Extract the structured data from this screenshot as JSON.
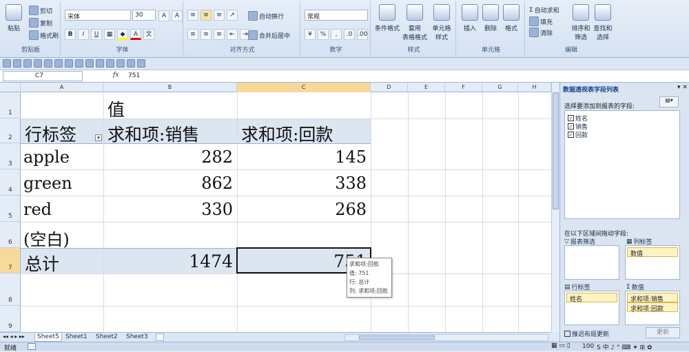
{
  "ribbon": {
    "clipboard": {
      "paste": "粘贴",
      "cut": "剪切",
      "copy": "复制",
      "format_painter": "格式刷",
      "label": "剪贴板"
    },
    "font": {
      "name": "宋体",
      "size": "30",
      "bold": "B",
      "italic": "I",
      "underline": "U",
      "label": "字体"
    },
    "alignment": {
      "wrap": "自动换行",
      "merge": "合并后居中",
      "label": "对齐方式"
    },
    "number": {
      "format": "常规",
      "percent": "%",
      "comma": ",",
      "label": "数字"
    },
    "styles": {
      "conditional": "条件格式",
      "table_format": "套用\n表格格式",
      "cell_style": "单元格\n样式",
      "label": "样式"
    },
    "cells": {
      "insert": "插入",
      "delete": "删除",
      "format": "格式",
      "label": "单元格"
    },
    "editing": {
      "autosum": "自动求和",
      "fill": "填充",
      "clear": "清除",
      "sort_filter": "排序和\n筛选",
      "find_select": "查找和\n选择",
      "label": "编辑"
    }
  },
  "formula": {
    "name_box": "C7",
    "fx": "fx",
    "value": "751"
  },
  "columns": [
    "A",
    "B",
    "C",
    "D",
    "E",
    "F",
    "G",
    "H"
  ],
  "rows": [
    "1",
    "2",
    "3",
    "4",
    "5",
    "6",
    "7",
    "8",
    "9"
  ],
  "pivot": {
    "values_header": "值",
    "row_label": "行标签",
    "col_b": "求和项:销售",
    "col_c": "求和项:回款",
    "data": [
      {
        "name": "apple",
        "sales": "282",
        "payment": "145"
      },
      {
        "name": "green",
        "sales": "862",
        "payment": "338"
      },
      {
        "name": "red",
        "sales": "330",
        "payment": "268"
      },
      {
        "name": "(空白)",
        "sales": "",
        "payment": ""
      }
    ],
    "total_label": "总计",
    "total_sales": "1474",
    "total_payment": "751"
  },
  "tooltip": {
    "line1": "求和项:回款",
    "line2": "值: 751",
    "line3": "行: 总计",
    "line4": "列: 求和项:回款"
  },
  "pane": {
    "title": "数据透视表字段列表",
    "choose": "选择要添加到报表的字段:",
    "fields": [
      "姓名",
      "销售",
      "回款"
    ],
    "drag_hint": "在以下区域间拖动字段:",
    "report_filter": "报表筛选",
    "col_labels": "列标签",
    "col_value": "数值",
    "row_labels": "行标签",
    "values": "数值",
    "row_chip": "姓名",
    "val_chip1": "求和项:销售",
    "val_chip2": "求和项:回款",
    "defer": "推迟布局更新",
    "update": "更新"
  },
  "sheets": [
    "Sheet5",
    "Sheet1",
    "Sheet2",
    "Sheet3"
  ],
  "status": {
    "ready": "就绪",
    "zoom": "100"
  }
}
